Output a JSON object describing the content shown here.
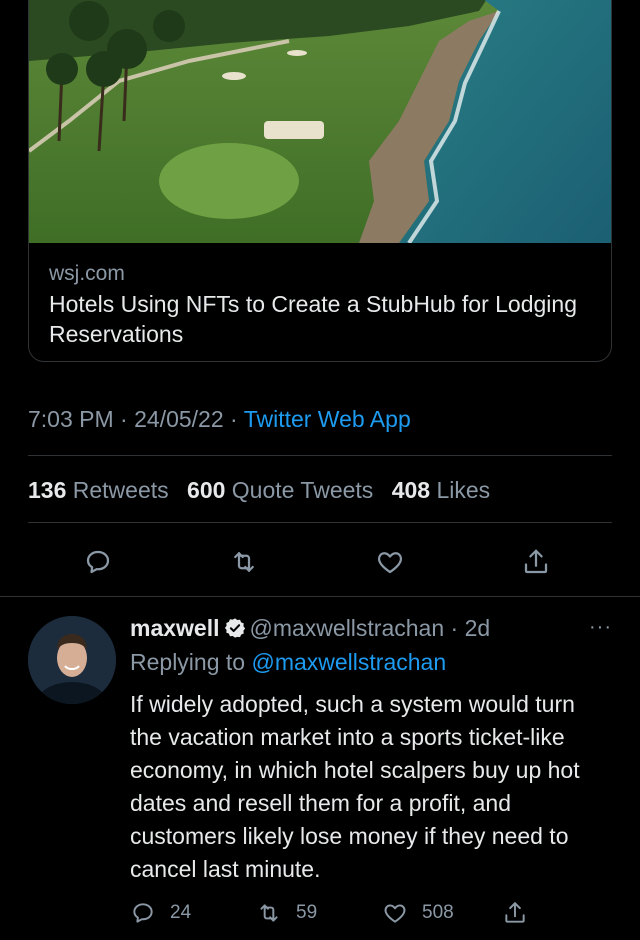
{
  "link_card": {
    "domain": "wsj.com",
    "title": "Hotels Using NFTs to Create a StubHub for Lodging Reservations"
  },
  "tweet": {
    "time": "7:03 PM",
    "date": "24/05/22",
    "source": "Twitter Web App",
    "separator": "·",
    "stats": {
      "retweets_count": "136",
      "retweets_label": "Retweets",
      "quotes_count": "600",
      "quotes_label": "Quote Tweets",
      "likes_count": "408",
      "likes_label": "Likes"
    }
  },
  "reply": {
    "name": "maxwell",
    "handle": "@maxwellstrachan",
    "age": "2d",
    "separator": "·",
    "replying_prefix": "Replying to",
    "replying_to": "@maxwellstrachan",
    "text": "If widely adopted, such a system would turn the vacation market into a sports ticket-like economy, in which hotel scalpers buy up hot dates and resell them for a profit, and customers likely lose money if they need to cancel last minute.",
    "more": "···",
    "counts": {
      "replies": "24",
      "retweets": "59",
      "likes": "508"
    }
  },
  "icons": {
    "reply": "reply-icon",
    "retweet": "retweet-icon",
    "like": "heart-icon",
    "share": "share-icon",
    "verified": "verified-badge-icon"
  },
  "colors": {
    "background": "#000000",
    "accent": "#1d9bf0",
    "secondary_text": "#8b98a5",
    "primary_text": "#e7e9ea",
    "divider": "#2f3336"
  }
}
